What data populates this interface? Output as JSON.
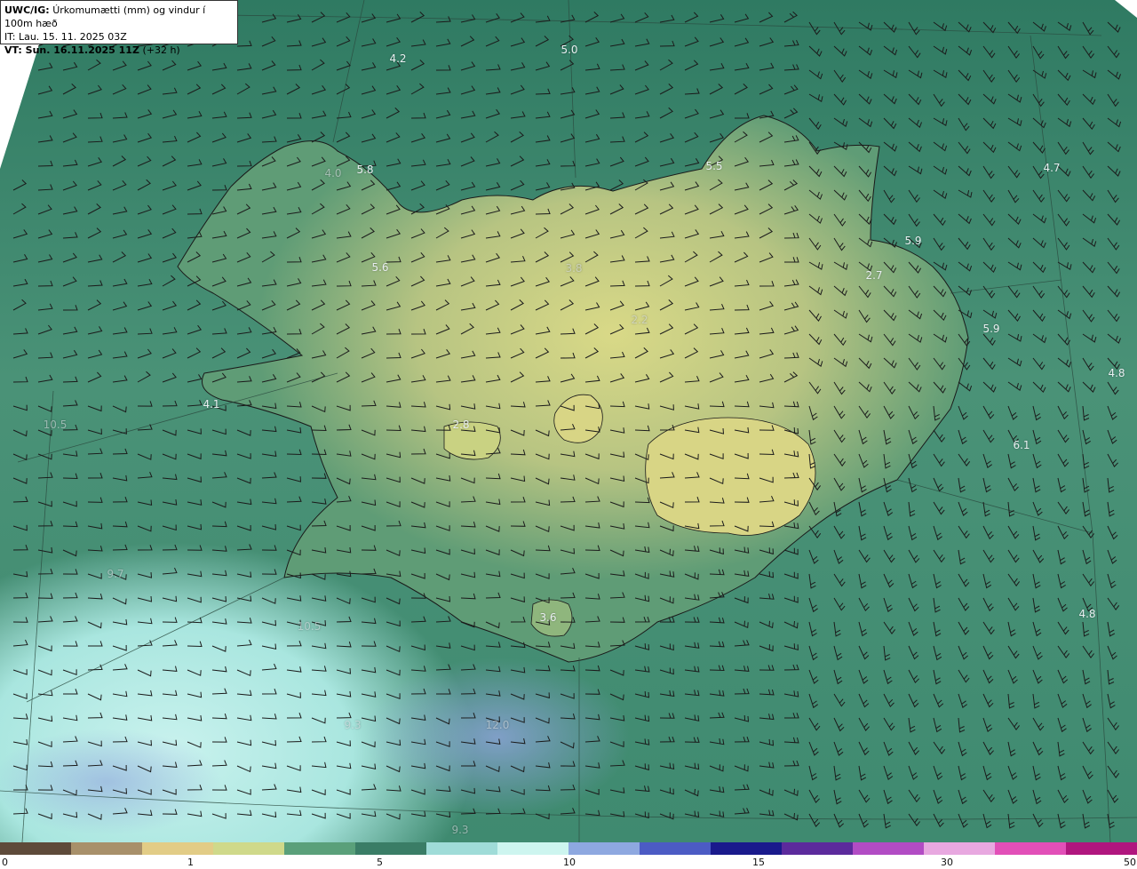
{
  "header": {
    "product": "UWC/IG:",
    "product_desc": "Úrkomumætti (mm) og vindur í 100m hæð",
    "init_time": "IT: Lau. 15. 11. 2025 03Z",
    "valid_time_bold": "VT: Sun. 16.11.2025 11Z",
    "valid_offset": "(+32 h)"
  },
  "map_labels": [
    {
      "text": "5.0"
    },
    {
      "text": "4.2"
    },
    {
      "text": "5.8"
    },
    {
      "text": "4.0"
    },
    {
      "text": "5.5"
    },
    {
      "text": "4.7"
    },
    {
      "text": "5.6"
    },
    {
      "text": "5.9"
    },
    {
      "text": "2.7"
    },
    {
      "text": "5.9"
    },
    {
      "text": "4.8"
    },
    {
      "text": "3.8"
    },
    {
      "text": "2.2"
    },
    {
      "text": "4.1"
    },
    {
      "text": "2.8"
    },
    {
      "text": "6.1"
    },
    {
      "text": "10.5"
    },
    {
      "text": "9.7"
    },
    {
      "text": "10.5"
    },
    {
      "text": "3.6"
    },
    {
      "text": "4.8"
    },
    {
      "text": "9.3"
    },
    {
      "text": "12.0"
    },
    {
      "text": "9.3"
    }
  ],
  "colorbar": {
    "ticks": [
      "0",
      "1",
      "5",
      "10",
      "15",
      "30",
      "50"
    ],
    "colors": [
      "#5e4a3a",
      "#a8906a",
      "#e2cc86",
      "#cfd98a",
      "#5aa07a",
      "#3a7d66",
      "#9fdcd8",
      "#cdf5ef",
      "#8ea8e0",
      "#4c5bc4",
      "#1a1a8c",
      "#5c2a9c",
      "#b24cc4",
      "#e8a8e0",
      "#e24fb8",
      "#b0167e"
    ]
  }
}
